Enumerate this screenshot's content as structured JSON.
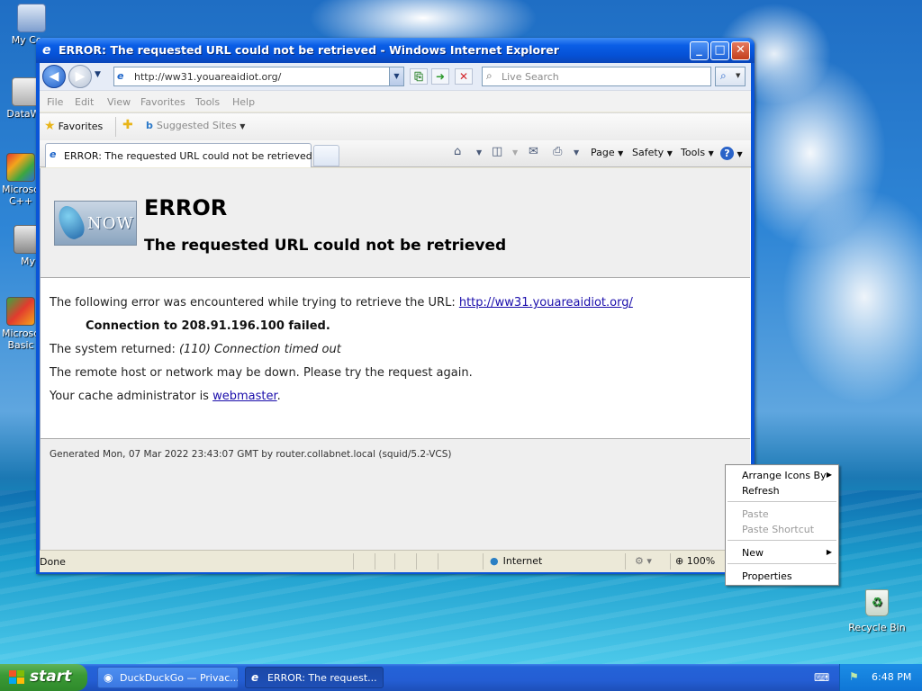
{
  "desktop": {
    "icons": [
      {
        "label": "My Com"
      },
      {
        "label": "DataWa"
      },
      {
        "label": "Microso"
      },
      {
        "label": "C++"
      },
      {
        "label": "My"
      },
      {
        "label": "Microso"
      },
      {
        "label": "Basic"
      }
    ],
    "recycle_bin": "Recycle Bin"
  },
  "window": {
    "title": "ERROR: The requested URL could not be retrieved - Windows Internet Explorer",
    "address": "http://ww31.youareaidiot.org/",
    "search_placeholder": "Live Search",
    "menu": [
      "File",
      "Edit",
      "View",
      "Favorites",
      "Tools",
      "Help"
    ],
    "favorites_label": "Favorites",
    "suggested_sites": "Suggested Sites",
    "tab_title": "ERROR: The requested URL could not be retrieved",
    "commands": {
      "page": "Page",
      "safety": "Safety",
      "tools": "Tools"
    }
  },
  "error_page": {
    "heading": "ERROR",
    "subheading": "The requested URL could not be retrieved",
    "logo_text": "NOW",
    "intro": "The following error was encountered while trying to retrieve the URL:",
    "url": "http://ww31.youareaidiot.org/",
    "failure": "Connection to 208.91.196.100 failed.",
    "system_prefix": "The system returned:",
    "system_error": "(110) Connection timed out",
    "remote_msg": "The remote host or network may be down. Please try the request again.",
    "admin_prefix": "Your cache administrator is",
    "admin_link": "webmaster",
    "admin_suffix": ".",
    "generated": "Generated Mon, 07 Mar 2022 23:43:07 GMT by router.collabnet.local (squid/5.2-VCS)"
  },
  "statusbar": {
    "status": "Done",
    "zone": "Internet",
    "zoom": "100%"
  },
  "context_menu": {
    "arrange": "Arrange Icons By",
    "refresh": "Refresh",
    "paste": "Paste",
    "paste_shortcut": "Paste Shortcut",
    "new": "New",
    "properties": "Properties"
  },
  "taskbar": {
    "start": "start",
    "tasks": [
      {
        "label": "DuckDuckGo — Privac..."
      },
      {
        "label": "ERROR: The request..."
      }
    ],
    "clock": "6:48 PM"
  }
}
